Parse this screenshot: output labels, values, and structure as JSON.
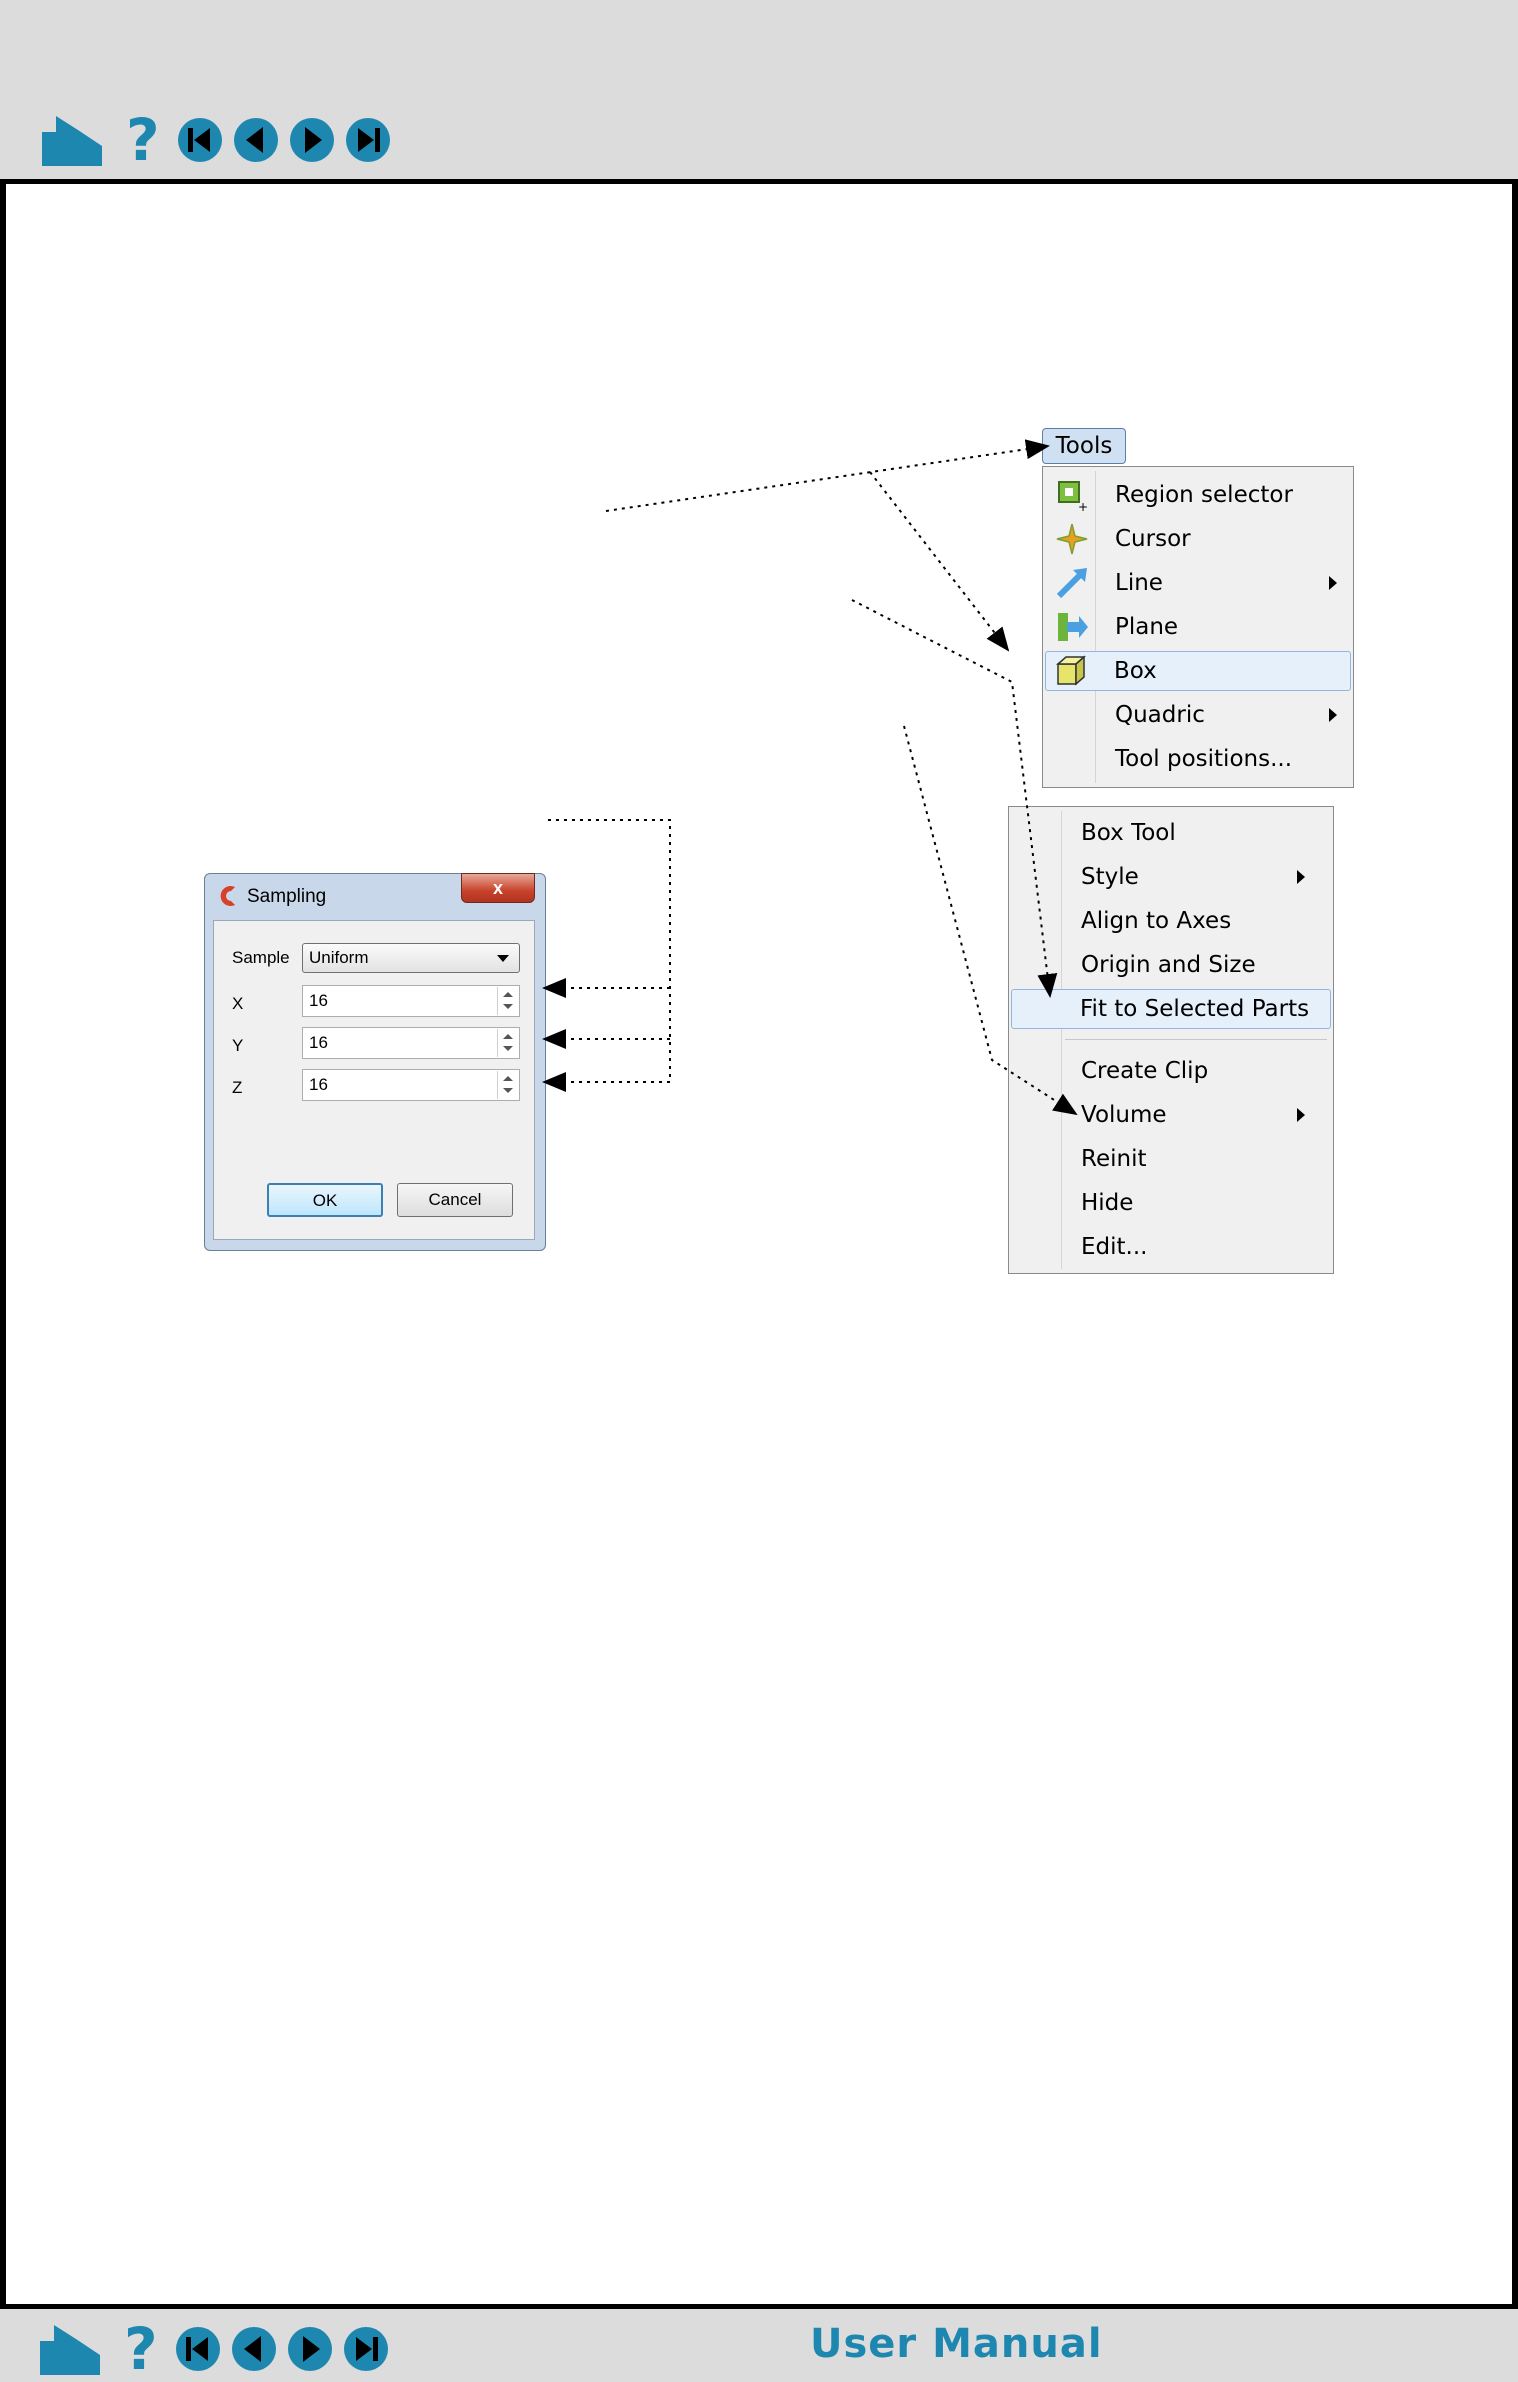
{
  "nav": {
    "icons": [
      "home-icon",
      "help-icon",
      "first-page-icon",
      "previous-page-icon",
      "next-page-icon",
      "last-page-icon"
    ]
  },
  "footer": {
    "title": "User Manual"
  },
  "tools_menu": {
    "tab_label": "Tools",
    "items": [
      {
        "label": "Region selector",
        "icon": "region-selector-icon"
      },
      {
        "label": "Cursor",
        "icon": "cursor-icon"
      },
      {
        "label": "Line",
        "icon": "line-icon",
        "submenu": true
      },
      {
        "label": "Plane",
        "icon": "plane-icon"
      },
      {
        "label": "Box",
        "icon": "box-icon",
        "highlighted": true
      },
      {
        "label": "Quadric",
        "submenu": true
      },
      {
        "label": "Tool positions..."
      }
    ]
  },
  "context_menu": {
    "items": [
      {
        "label": "Box Tool"
      },
      {
        "label": "Style",
        "submenu": true
      },
      {
        "label": "Align to Axes"
      },
      {
        "label": "Origin and Size"
      },
      {
        "label": "Fit to Selected Parts",
        "highlighted": true
      },
      {
        "label": "Create Clip"
      },
      {
        "label": "Volume",
        "submenu": true
      },
      {
        "label": "Reinit"
      },
      {
        "label": "Hide"
      },
      {
        "label": "Edit..."
      }
    ]
  },
  "sampling_dialog": {
    "title": "Sampling",
    "close_label": "x",
    "sample_label": "Sample",
    "sample_value": "Uniform",
    "x_label": "X",
    "x_value": "16",
    "y_label": "Y",
    "y_value": "16",
    "z_label": "Z",
    "z_value": "16",
    "ok_label": "OK",
    "cancel_label": "Cancel"
  },
  "colors": {
    "nav_blue": "#1e87b0",
    "highlight": "#e5f0fb"
  }
}
